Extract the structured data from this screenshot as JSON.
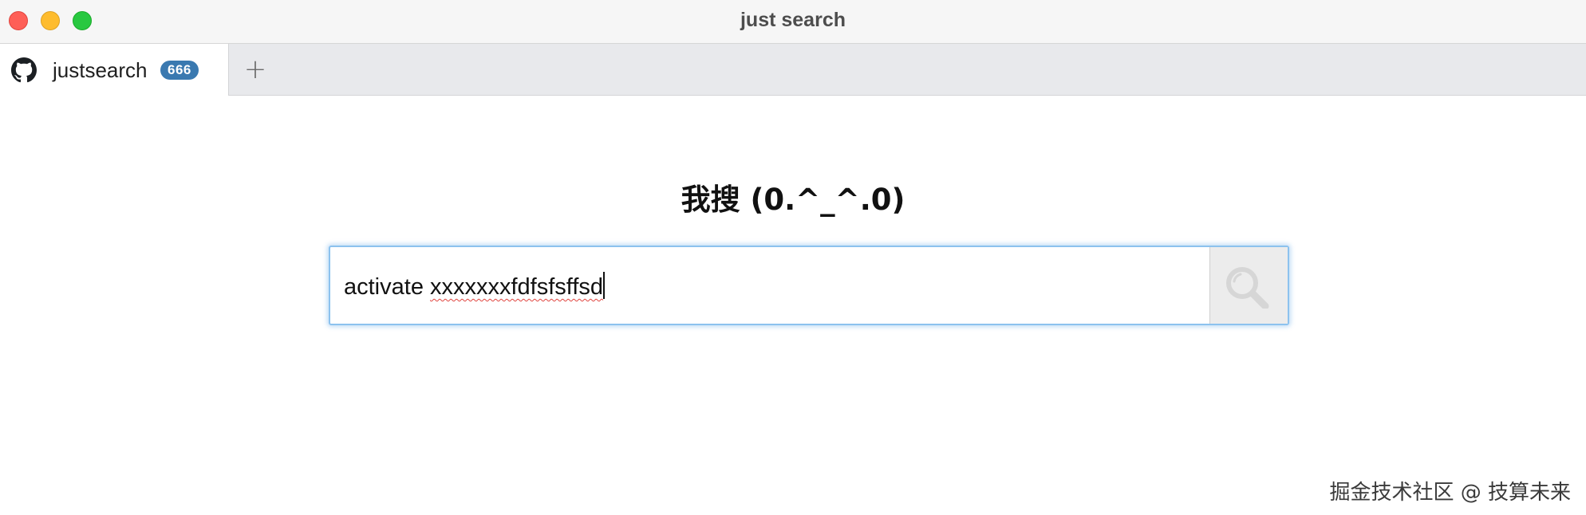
{
  "window": {
    "title": "just search"
  },
  "tabs": [
    {
      "label": "justsearch",
      "badge": "666",
      "icon": "github-icon"
    }
  ],
  "new_tab_label": "+",
  "main": {
    "heading": "我搜 (0.^_^.0)",
    "search": {
      "value_prefix": "activate ",
      "value_misspelled": "xxxxxxxfdfsfsffsd",
      "value": "activate xxxxxxxfdfsfsffsd",
      "button_icon": "magnifier-icon"
    }
  },
  "watermark": "掘金技术社区 @ 技算未来",
  "colors": {
    "focus_border": "#8cc2ee",
    "badge_bg": "#3a79b0",
    "close": "#fe5f57",
    "minimize": "#febc2e",
    "maximize": "#28c840"
  }
}
